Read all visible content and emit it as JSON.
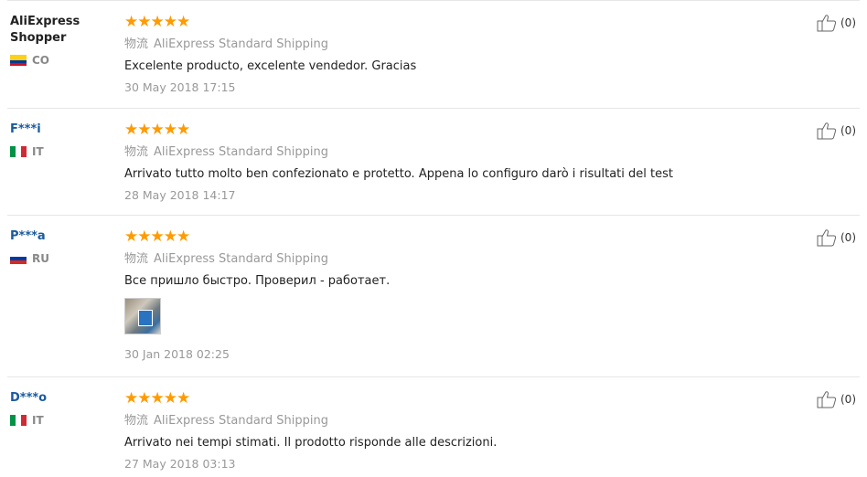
{
  "reviews": [
    {
      "name": "AliExpress Shopper",
      "country": "CO",
      "flag": [
        "#fcd116",
        "#003893",
        "#ce1126"
      ],
      "flag_dir": "h",
      "stars": 5,
      "logistics_label": "物流",
      "logistics": "AliExpress Standard Shipping",
      "text": "Excelente producto, excelente vendedor. Gracias",
      "date": "30 May 2018 17:15",
      "useful": "(0)",
      "has_photo": false
    },
    {
      "name": "F***i",
      "country": "IT",
      "flag": [
        "#009246",
        "#ffffff",
        "#ce2b37"
      ],
      "flag_dir": "v",
      "stars": 5,
      "logistics_label": "物流",
      "logistics": "AliExpress Standard Shipping",
      "text": "Arrivato tutto molto ben confezionato e protetto. Appena lo configuro darò i risultati del test",
      "date": "28 May 2018 14:17",
      "useful": "(0)",
      "has_photo": false
    },
    {
      "name": "P***a",
      "country": "RU",
      "flag": [
        "#ffffff",
        "#0039a6",
        "#d52b1e"
      ],
      "flag_dir": "h",
      "stars": 5,
      "logistics_label": "物流",
      "logistics": "AliExpress Standard Shipping",
      "text": "Все пришло быстро. Проверил - работает.",
      "date": "30 Jan 2018 02:25",
      "useful": "(0)",
      "has_photo": true
    },
    {
      "name": "D***o",
      "country": "IT",
      "flag": [
        "#009246",
        "#ffffff",
        "#ce2b37"
      ],
      "flag_dir": "v",
      "stars": 5,
      "logistics_label": "物流",
      "logistics": "AliExpress Standard Shipping",
      "text": "Arrivato nei tempi stimati. Il prodotto risponde alle descrizioni.",
      "date": "27 May 2018 03:13",
      "useful": "(0)",
      "has_photo": false
    }
  ],
  "colors": {
    "star": "#ff9a00",
    "masked_name": "#1a5a9e",
    "meta": "#999999"
  }
}
